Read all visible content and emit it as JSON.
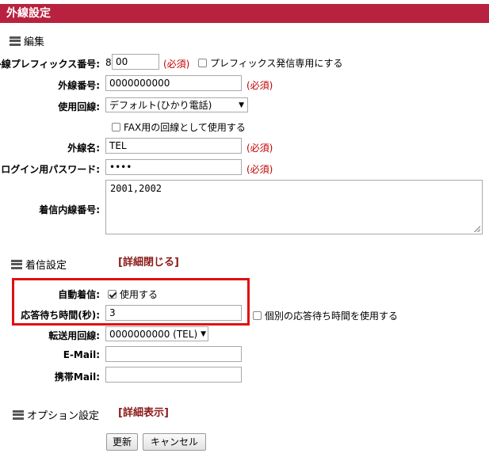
{
  "title": "外線設定",
  "edit_section": {
    "heading": "編集",
    "prefix": {
      "label": "外線プレフィックス番号:",
      "lead_digit": "8",
      "value": "00",
      "required": "(必須)",
      "checkbox_label": "プレフィックス発信専用にする",
      "checked": false
    },
    "outside_number": {
      "label": "外線番号:",
      "value": "0000000000",
      "required": "(必須)"
    },
    "line": {
      "label": "使用回線:",
      "selected": "デフォルト(ひかり電話)"
    },
    "fax": {
      "checkbox_label": "FAX用の回線として使用する",
      "checked": false
    },
    "outside_name": {
      "label": "外線名:",
      "value": "TEL",
      "required": "(必須)"
    },
    "login_password": {
      "label": "ログイン用パスワード:",
      "value": "••••",
      "required": "(必須)"
    },
    "incoming_ext": {
      "label": "着信内線番号:",
      "value": "2001,2002"
    }
  },
  "incoming_section": {
    "heading": "着信設定",
    "detail_link": "[詳細閉じる]",
    "auto_answer": {
      "label": "自動着信:",
      "checkbox_label": "使用する",
      "checked": true
    },
    "answer_wait": {
      "label": "応答待ち時間(秒):",
      "value": "3",
      "checkbox_label": "個別の応答待ち時間を使用する",
      "checked": false
    },
    "transfer_line": {
      "label": "転送用回線:",
      "selected": "0000000000 (TEL)"
    },
    "email": {
      "label": "E-Mail:",
      "value": ""
    },
    "mobile_mail": {
      "label": "携帯Mail:",
      "value": ""
    }
  },
  "option_section": {
    "heading": "オプション設定",
    "detail_link": "[詳細表示]"
  },
  "buttons": {
    "update": "更新",
    "cancel": "キャンセル"
  },
  "colors": {
    "title_bar": "#b8223f",
    "required": "#c00000",
    "link": "#8b1a1a",
    "highlight": "#e01010"
  }
}
